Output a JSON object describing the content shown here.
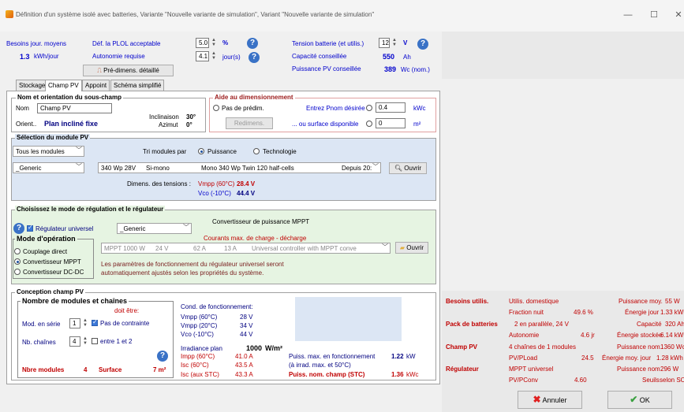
{
  "window": {
    "title": "Définition d'un système isolé avec batteries, Variante  \"Nouvelle variante de simulation\", Variant  \"Nouvelle variante de simulation\"",
    "minimize": "—",
    "maximize": "☐",
    "close": "✕"
  },
  "header": {
    "needs_label": "Besoins jour. moyens",
    "needs_value": "1.3",
    "needs_unit": "kWh/jour",
    "plol_label": "Déf. la PLOL acceptable",
    "plol_value": "5.0",
    "plol_unit": "%",
    "autonomy_label": "Autonomie requise",
    "autonomy_value": "4.1",
    "autonomy_unit": "jour(s)",
    "predim_button": "Pré-dimens. détaillé",
    "battery_voltage_label": "Tension batterie (et utilis.)",
    "battery_voltage_value": "12",
    "battery_voltage_unit": "V",
    "capacity_label": "Capacité conseillée",
    "capacity_value": "550",
    "capacity_unit": "Ah",
    "pv_power_label": "Puissance PV conseillée",
    "pv_power_value": "389",
    "pv_power_unit": "Wc (nom.)"
  },
  "tabs": [
    "Stockage",
    "Champ PV",
    "Appoint",
    "Schéma simplifié"
  ],
  "subfield": {
    "group_title": "Nom et orientation du sous-champ",
    "name_label": "Nom",
    "name_value": "Champ PV",
    "orient_label": "Orient..",
    "orient_value": "Plan incliné fixe",
    "tilt_label": "Inclinaison",
    "tilt_value": "30°",
    "azimuth_label": "Azimut",
    "azimuth_value": "0°"
  },
  "sizing_help": {
    "title": "Aide au dimensionnement",
    "no_predim": "Pas de prédim.",
    "pnom_label": "Entrez Pnom désirée",
    "pnom_value": "0.4",
    "pnom_unit": "kWc",
    "area_label": "... ou surface disponible",
    "area_value": "0",
    "area_unit": "m²",
    "resize_button": "Redimens."
  },
  "module": {
    "title": "Sélection du module PV",
    "filter": "Tous les modules",
    "sort_label": "Tri modules par",
    "sort_power": "Puissance",
    "sort_tech": "Technologie",
    "manufacturer": "_Generic",
    "model": "340 Wp 28V",
    "tech": "Si-mono",
    "description": "Mono 340 Wp Twin 120 half-cells",
    "since": "Depuis 20:",
    "open_button": "Ouvrir",
    "dim_label": "Dimens. des tensions :",
    "vmpp_label": "Vmpp (60°C)",
    "vmpp_value": "28.4 V",
    "voc_label": "Vco (-10°C)",
    "voc_value": "44.4 V"
  },
  "regulator": {
    "title": "Choisissez le mode de régulation et le régulateur",
    "universal_label": "Régulateur universel",
    "manufacturer": "_Generic",
    "converter_title": "Convertisseur de puissance MPPT",
    "currents_title": "Courants max. de charge - décharge",
    "model": "MPPT 1000 W",
    "voltage": "24 V",
    "current": "62 A",
    "current2": "13 A",
    "description": "Universal controller with MPPT conve",
    "open_button": "Ouvrir",
    "mode_title": "Mode d'opération",
    "mode_direct": "Couplage direct",
    "mode_mppt": "Convertisseur MPPT",
    "mode_dcdc": "Convertisseur DC-DC",
    "info_line1": "Les paramètres de fonctionnement du régulateur universel seront",
    "info_line2": "automatiquement ajustés selon les propriétés du système."
  },
  "design": {
    "title": "Conception champ PV",
    "modules_title": "Nombre de modules et chaînes",
    "must_be": "doit être:",
    "series_label": "Mod. en série",
    "series_value": "1",
    "no_constraint": "Pas de contrainte",
    "strings_label": "Nb. chaînes",
    "strings_value": "4",
    "between": "entre 1 et 2",
    "nb_modules_label": "Nbre modules",
    "nb_modules_value": "4",
    "area_label": "Surface",
    "area_value": "7 m²",
    "op_cond_title": "Cond. de fonctionnement:",
    "vmpp60_label": "Vmpp (60°C)",
    "vmpp60_value": "28 V",
    "vmpp20_label": "Vmpp (20°C)",
    "vmpp20_value": "34 V",
    "voc_label": "Vco (-10°C)",
    "voc_value": "44 V",
    "irr_label": "Irradiance plan",
    "irr_value": "1000",
    "irr_unit": "W/m²",
    "impp_label": "Impp (60°C)",
    "impp_value": "41.0 A",
    "isc60_label": "Isc (60°C)",
    "isc60_value": "43.5 A",
    "isc_stc_label": "Isc (aux STC)",
    "isc_stc_value": "43.3 A",
    "pmax_label": "Puiss. max. en fonctionnement",
    "pmax_sub": "(à irrad. max. et 50°C)",
    "pmax_value": "1.22",
    "pmax_unit": "kW",
    "pnom_label": "Puiss. nom. champ (STC)",
    "pnom_value": "1.36",
    "pnom_unit": "kWc"
  },
  "summary": {
    "needs_head": "Besoins utilis.",
    "needs_type": "Utilis. domestique",
    "night_label": "Fraction nuit",
    "night_value": "49.6 %",
    "avg_power_label": "Puissance moy.",
    "avg_power_value": "55 W",
    "daily_energy_label": "Énergie jour",
    "daily_energy_value": "1.33 kWh",
    "battery_head": "Pack de batteries",
    "battery_config": "2 en parallèle, 24 V",
    "capacity_label": "Capacité",
    "capacity_value": "320 Ah",
    "autonomy_label": "Autonomie",
    "autonomy_value": "4.6 jr",
    "stored_label": "Énergie stockée",
    "stored_value": "6.14 kWh",
    "pv_head": "Champ PV",
    "pv_config": "4 chaînes de 1 modules",
    "pnom_label": "Puissance nom.",
    "pnom_value": "1360 Wc",
    "pvload_label": "PV/PLoad",
    "pvload_value": "24.5",
    "daily_max_label": "Énergie moy. jour",
    "daily_max_value": "1.28 kWh",
    "reg_head": "Régulateur",
    "reg_type": "MPPT universel",
    "reg_power_label": "Puissance nom.",
    "reg_power_value": "296 W",
    "pvconv_label": "PV/PConv",
    "pvconv_value": "4.60",
    "thresholds_label": "Seuils",
    "thresholds_value": "selon SOC"
  },
  "buttons": {
    "cancel": "Annuler",
    "ok": "OK"
  },
  "colors": {
    "accent_blue": "#0000cc",
    "red_value": "#c00000",
    "module_bg": "#dce6f4",
    "regulator_bg": "#e6f4e2",
    "sizing_border": "#e0a0a0"
  }
}
